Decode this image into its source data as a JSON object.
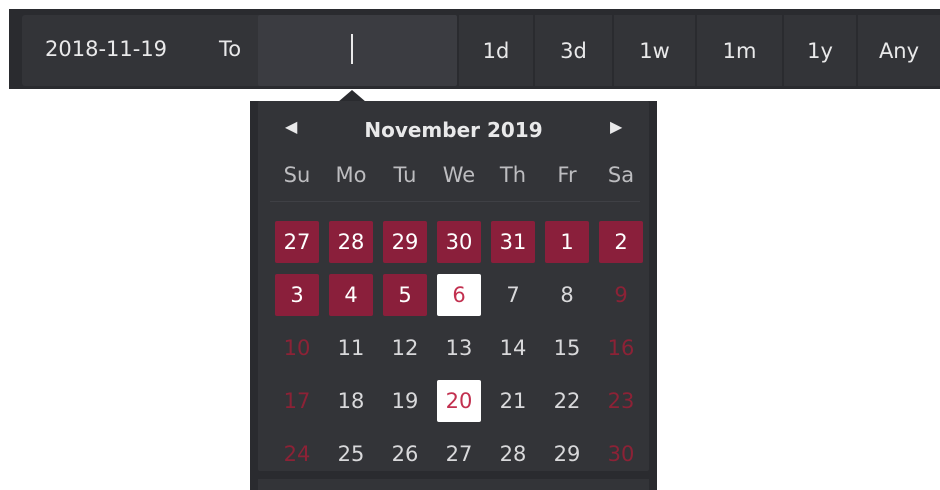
{
  "toolbar": {
    "from_value": "2018-11-19",
    "to_label": "To",
    "to_value": "",
    "ranges": [
      "1d",
      "3d",
      "1w",
      "1m",
      "1y",
      "Any"
    ]
  },
  "calendar": {
    "prev_icon": "◀",
    "next_icon": "▶",
    "month_title": "November 2019",
    "weekdays": [
      "Su",
      "Mo",
      "Tu",
      "We",
      "Th",
      "Fr",
      "Sa"
    ],
    "weeks": [
      [
        {
          "d": "27",
          "s": "sel"
        },
        {
          "d": "28",
          "s": "sel"
        },
        {
          "d": "29",
          "s": "sel"
        },
        {
          "d": "30",
          "s": "sel"
        },
        {
          "d": "31",
          "s": "sel"
        },
        {
          "d": "1",
          "s": "sel"
        },
        {
          "d": "2",
          "s": "sel"
        }
      ],
      [
        {
          "d": "3",
          "s": "sel"
        },
        {
          "d": "4",
          "s": "sel"
        },
        {
          "d": "5",
          "s": "sel"
        },
        {
          "d": "6",
          "s": "today"
        },
        {
          "d": "7",
          "s": ""
        },
        {
          "d": "8",
          "s": ""
        },
        {
          "d": "9",
          "s": "weekend"
        }
      ],
      [
        {
          "d": "10",
          "s": "weekend"
        },
        {
          "d": "11",
          "s": ""
        },
        {
          "d": "12",
          "s": ""
        },
        {
          "d": "13",
          "s": ""
        },
        {
          "d": "14",
          "s": ""
        },
        {
          "d": "15",
          "s": ""
        },
        {
          "d": "16",
          "s": "weekend"
        }
      ],
      [
        {
          "d": "17",
          "s": "weekend"
        },
        {
          "d": "18",
          "s": ""
        },
        {
          "d": "19",
          "s": ""
        },
        {
          "d": "20",
          "s": "today"
        },
        {
          "d": "21",
          "s": ""
        },
        {
          "d": "22",
          "s": ""
        },
        {
          "d": "23",
          "s": "weekend"
        }
      ],
      [
        {
          "d": "24",
          "s": "weekend"
        },
        {
          "d": "25",
          "s": ""
        },
        {
          "d": "26",
          "s": ""
        },
        {
          "d": "27",
          "s": ""
        },
        {
          "d": "28",
          "s": ""
        },
        {
          "d": "29",
          "s": ""
        },
        {
          "d": "30",
          "s": "weekend"
        }
      ]
    ]
  },
  "colors": {
    "toolbar_bg": "#2a2b2f",
    "panel_bg": "#333438",
    "selected": "#8a1f3b",
    "today_text": "#c2304f",
    "weekend_text": "#8c2236"
  }
}
